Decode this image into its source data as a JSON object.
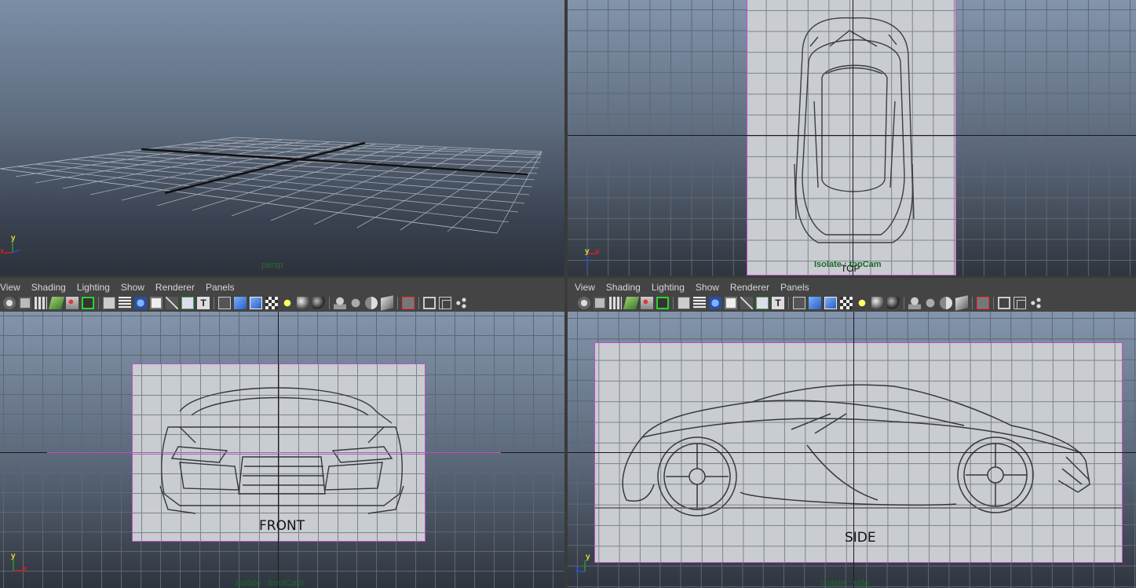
{
  "panels": {
    "persp": {
      "camera": "persp"
    },
    "top": {
      "camera": "Isolate : topCam",
      "overlay_label": "TOP"
    },
    "front": {
      "camera": "Isolate : frontCam",
      "caption": "FRONT"
    },
    "side": {
      "camera": "Isolate : side",
      "caption": "SIDE"
    }
  },
  "panel_menu": [
    "View",
    "Shading",
    "Lighting",
    "Show",
    "Renderer",
    "Panels"
  ],
  "toolbar_icons": [
    "select-camera-icon",
    "camera-attributes-icon",
    "bookmarks-icon",
    "image-plane-icon",
    "2d-pan-icon",
    "grease-pencil-icon",
    "grid-icon",
    "film-gate-icon",
    "resolution-gate-icon",
    "gate-mask-icon",
    "field-chart-icon",
    "safe-action-icon",
    "safe-title-icon",
    "wireframe-icon",
    "smooth-shade-icon",
    "wireframe-on-shaded-icon",
    "textured-icon",
    "use-all-lights-icon",
    "shadows-icon",
    "ambient-occlusion-icon",
    "motion-blur-icon",
    "anti-aliasing-icon",
    "depth-of-field-icon",
    "xray-icon",
    "xray-joints-icon",
    "isolate-select-icon",
    "bounding-box-icon",
    "component-icon",
    "hierarchy-icon"
  ],
  "gizmo": {
    "x": "x",
    "y": "y",
    "z": "z"
  },
  "colors": {
    "image_plane_border": "#c24ec6",
    "camera_label": "#1a6b2a",
    "axis_x": "#d02020",
    "axis_y": "#2a9a2a",
    "axis_z": "#2a4fd0"
  }
}
